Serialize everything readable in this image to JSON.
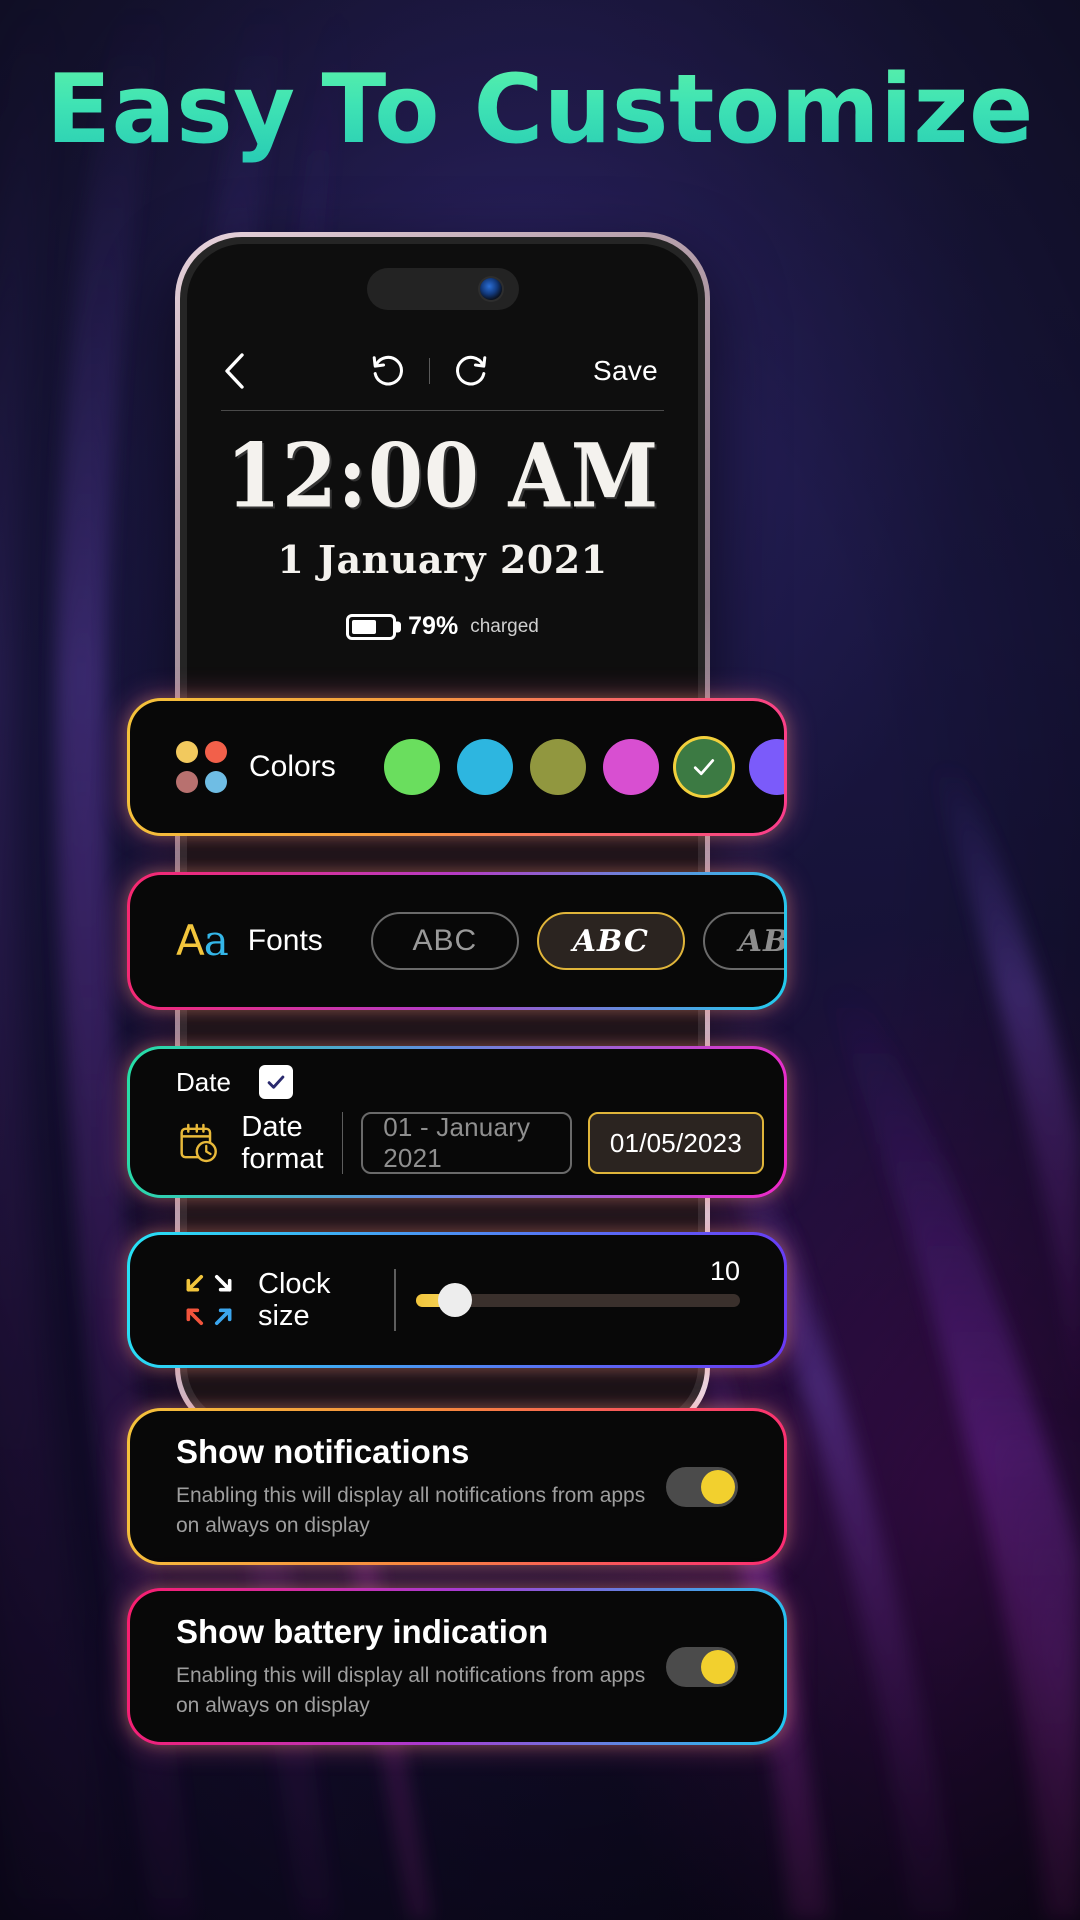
{
  "headline": {
    "word1": "Easy",
    "word2": "To Customize"
  },
  "phone": {
    "toolbar": {
      "back_icon": "chevron-left-icon",
      "undo_icon": "undo-icon",
      "redo_icon": "redo-icon",
      "save_label": "Save"
    },
    "preview": {
      "time": "12:00 AM",
      "date": "1 January 2021",
      "battery_percent": "79%",
      "battery_status": "charged",
      "battery_fill_ratio": 0.62
    }
  },
  "cards": {
    "colors": {
      "label": "Colors",
      "icon": "four-dots-icon",
      "icon_dots": [
        "#f2c95e",
        "#f2604a",
        "#b8716f",
        "#6fbde4"
      ],
      "swatches": [
        {
          "name": "green",
          "hex": "#6ade5e",
          "selected": false
        },
        {
          "name": "cyan",
          "hex": "#2db6e0",
          "selected": false
        },
        {
          "name": "olive",
          "hex": "#91973f",
          "selected": false
        },
        {
          "name": "magenta",
          "hex": "#d84fd1",
          "selected": false
        },
        {
          "name": "forest",
          "hex": "#3c7a43",
          "selected": true
        },
        {
          "name": "violet",
          "hex": "#7b5bfa",
          "selected": false
        }
      ],
      "selected_ring": "#f2d03c"
    },
    "fonts": {
      "label": "Fonts",
      "icon": "aa-icon",
      "icon_letters": {
        "upper": "A",
        "lower": "a"
      },
      "options": [
        {
          "label": "ABC",
          "style": "sans",
          "selected": false
        },
        {
          "label": "ABC",
          "style": "script",
          "selected": true
        },
        {
          "label": "ABC",
          "style": "serif",
          "selected": false
        }
      ]
    },
    "date": {
      "toggle_label": "Date",
      "checked": true,
      "format_label": "Date format",
      "icon": "calendar-clock-icon",
      "options": [
        {
          "label": "01 - January 2021",
          "selected": false
        },
        {
          "label": "01/05/2023",
          "selected": true
        }
      ]
    },
    "clock_size": {
      "label": "Clock size",
      "label_line1": "Clock",
      "label_line2": "size",
      "icon": "resize-arrows-icon",
      "value": "10",
      "fill_percent": 12
    },
    "notifications": {
      "title": "Show notifications",
      "subtitle_line1": "Enabling this will display all notifications from apps",
      "subtitle_line2": "on always on display",
      "enabled": true
    },
    "battery": {
      "title": "Show battery indication",
      "subtitle_line1": "Enabling this will display all notifications from apps",
      "subtitle_line2": "on always on display",
      "enabled": true
    }
  }
}
